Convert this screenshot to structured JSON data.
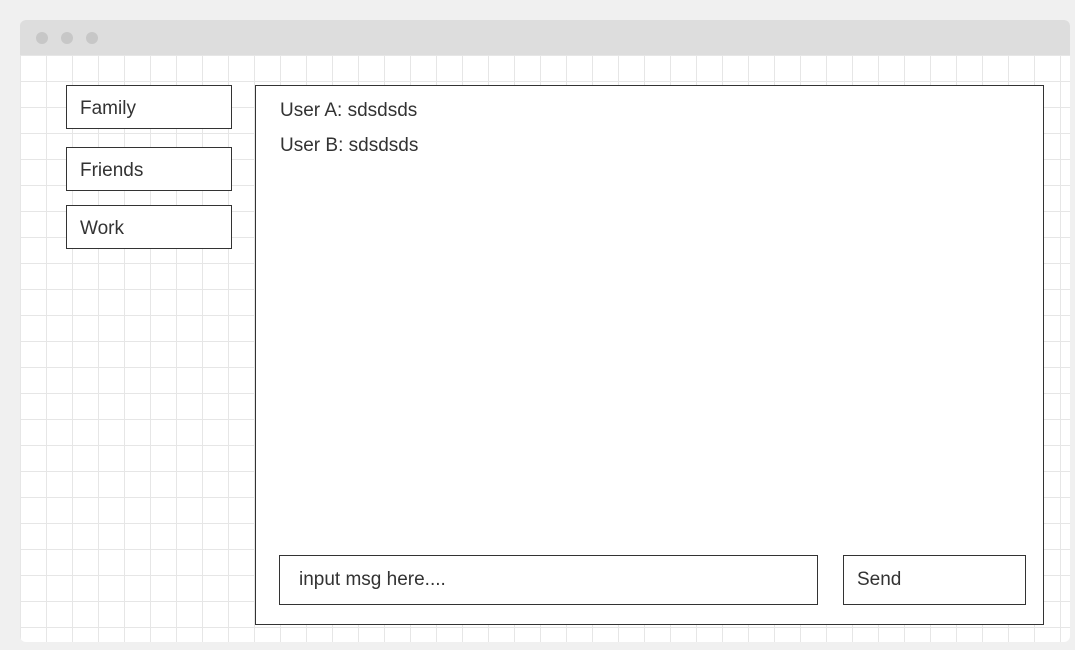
{
  "sidebar": {
    "items": [
      {
        "label": "Family"
      },
      {
        "label": "Friends"
      },
      {
        "label": "Work"
      }
    ]
  },
  "chat": {
    "messages": [
      {
        "text": "User A: sdsdsds"
      },
      {
        "text": "User B: sdsdsds"
      }
    ]
  },
  "composer": {
    "placeholder": "input msg here....",
    "value": "",
    "send_label": "Send"
  }
}
